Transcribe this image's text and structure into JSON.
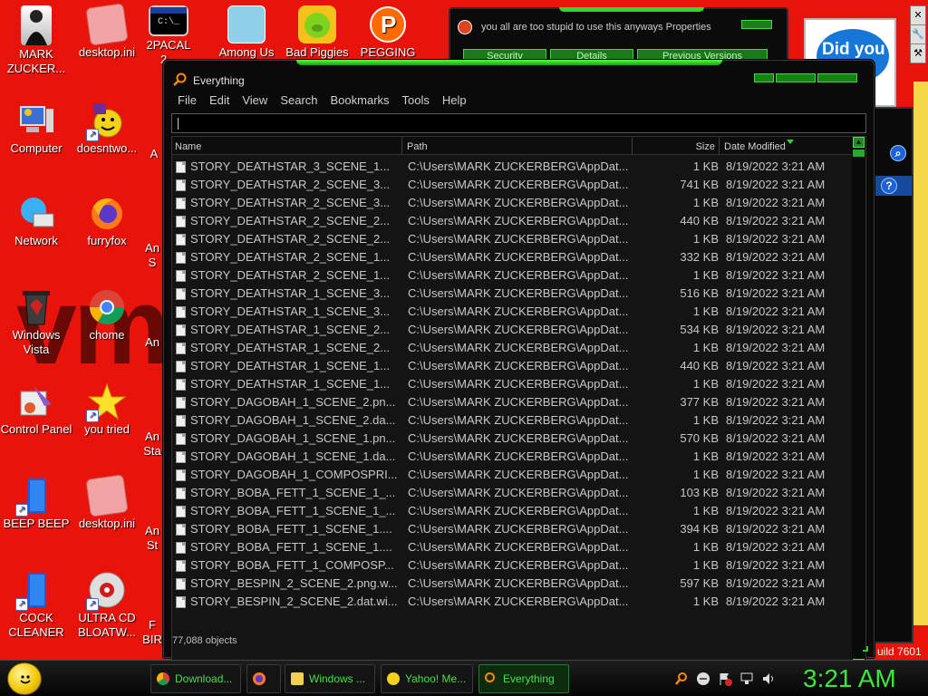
{
  "desktop": {
    "wallpaper_text": "vmO",
    "icons": [
      {
        "id": "mark-zuckerberg",
        "label": "MARK ZUCKER...",
        "icon": "user-figure-icon"
      },
      {
        "id": "desktop-ini-1",
        "label": "desktop.ini",
        "icon": "file-icon"
      },
      {
        "id": "2pacal",
        "label": "2PACAL 2...",
        "icon": "terminal-icon"
      },
      {
        "id": "among-us",
        "label": "Among Us",
        "icon": "game-icon"
      },
      {
        "id": "bad-piggies",
        "label": "Bad Piggies",
        "icon": "pig-icon"
      },
      {
        "id": "pegging",
        "label": "PEGGING",
        "icon": "p-logo-icon"
      },
      {
        "id": "computer",
        "label": "Computer",
        "icon": "computer-icon"
      },
      {
        "id": "doesntwo",
        "label": "doesntwo...",
        "icon": "yahoo-messenger-icon"
      },
      {
        "id": "network",
        "label": "Network",
        "icon": "network-icon"
      },
      {
        "id": "furryfox",
        "label": "furryfox",
        "icon": "firefox-icon"
      },
      {
        "id": "windows-vista",
        "label": "Windows Vista",
        "icon": "recycle-bin-icon"
      },
      {
        "id": "chome",
        "label": "chome",
        "icon": "chrome-icon"
      },
      {
        "id": "control-panel",
        "label": "Control Panel",
        "icon": "control-panel-icon"
      },
      {
        "id": "you-tried",
        "label": "you tried",
        "icon": "star-icon"
      },
      {
        "id": "beep-beep",
        "label": "BEEP BEEP",
        "icon": "blue-file-icon"
      },
      {
        "id": "desktop-ini-2",
        "label": "desktop.ini",
        "icon": "file-icon"
      },
      {
        "id": "cock-cleaner",
        "label": "COCK CLEANER",
        "icon": "blue-file-icon"
      },
      {
        "id": "ultra-cd",
        "label": "ULTRA CD BLOATW...",
        "icon": "cd-icon"
      },
      {
        "id": "partial-a1",
        "label": "A"
      },
      {
        "id": "partial-an1",
        "label": "An S"
      },
      {
        "id": "partial-an2",
        "label": "An"
      },
      {
        "id": "partial-an3",
        "label": "An Sta"
      },
      {
        "id": "partial-an4",
        "label": "An St"
      },
      {
        "id": "partial-bir",
        "label": "F BIR"
      }
    ]
  },
  "properties_window": {
    "title": "you all are too stupid to use this anyways Properties",
    "tabs": [
      "Security",
      "Details",
      "Previous Versions"
    ]
  },
  "side_window": {
    "did_you": "Did you",
    "help": "?",
    "build": "uild 7601"
  },
  "everything": {
    "title": "Everything",
    "menu": [
      "File",
      "Edit",
      "View",
      "Search",
      "Bookmarks",
      "Tools",
      "Help"
    ],
    "search_value": "",
    "columns": {
      "name": "Name",
      "path": "Path",
      "size": "Size",
      "date": "Date Modified"
    },
    "rows": [
      {
        "name": "STORY_DEATHSTAR_3_SCENE_1...",
        "path": "C:\\Users\\MARK ZUCKERBERG\\AppDat...",
        "size": "1 KB",
        "date": "8/19/2022 3:21 AM"
      },
      {
        "name": "STORY_DEATHSTAR_2_SCENE_3...",
        "path": "C:\\Users\\MARK ZUCKERBERG\\AppDat...",
        "size": "741 KB",
        "date": "8/19/2022 3:21 AM"
      },
      {
        "name": "STORY_DEATHSTAR_2_SCENE_3...",
        "path": "C:\\Users\\MARK ZUCKERBERG\\AppDat...",
        "size": "1 KB",
        "date": "8/19/2022 3:21 AM"
      },
      {
        "name": "STORY_DEATHSTAR_2_SCENE_2...",
        "path": "C:\\Users\\MARK ZUCKERBERG\\AppDat...",
        "size": "440 KB",
        "date": "8/19/2022 3:21 AM"
      },
      {
        "name": "STORY_DEATHSTAR_2_SCENE_2...",
        "path": "C:\\Users\\MARK ZUCKERBERG\\AppDat...",
        "size": "1 KB",
        "date": "8/19/2022 3:21 AM"
      },
      {
        "name": "STORY_DEATHSTAR_2_SCENE_1...",
        "path": "C:\\Users\\MARK ZUCKERBERG\\AppDat...",
        "size": "332 KB",
        "date": "8/19/2022 3:21 AM"
      },
      {
        "name": "STORY_DEATHSTAR_2_SCENE_1...",
        "path": "C:\\Users\\MARK ZUCKERBERG\\AppDat...",
        "size": "1 KB",
        "date": "8/19/2022 3:21 AM"
      },
      {
        "name": "STORY_DEATHSTAR_1_SCENE_3...",
        "path": "C:\\Users\\MARK ZUCKERBERG\\AppDat...",
        "size": "516 KB",
        "date": "8/19/2022 3:21 AM"
      },
      {
        "name": "STORY_DEATHSTAR_1_SCENE_3...",
        "path": "C:\\Users\\MARK ZUCKERBERG\\AppDat...",
        "size": "1 KB",
        "date": "8/19/2022 3:21 AM"
      },
      {
        "name": "STORY_DEATHSTAR_1_SCENE_2...",
        "path": "C:\\Users\\MARK ZUCKERBERG\\AppDat...",
        "size": "534 KB",
        "date": "8/19/2022 3:21 AM"
      },
      {
        "name": "STORY_DEATHSTAR_1_SCENE_2...",
        "path": "C:\\Users\\MARK ZUCKERBERG\\AppDat...",
        "size": "1 KB",
        "date": "8/19/2022 3:21 AM"
      },
      {
        "name": "STORY_DEATHSTAR_1_SCENE_1...",
        "path": "C:\\Users\\MARK ZUCKERBERG\\AppDat...",
        "size": "440 KB",
        "date": "8/19/2022 3:21 AM"
      },
      {
        "name": "STORY_DEATHSTAR_1_SCENE_1...",
        "path": "C:\\Users\\MARK ZUCKERBERG\\AppDat...",
        "size": "1 KB",
        "date": "8/19/2022 3:21 AM"
      },
      {
        "name": "STORY_DAGOBAH_1_SCENE_2.pn...",
        "path": "C:\\Users\\MARK ZUCKERBERG\\AppDat...",
        "size": "377 KB",
        "date": "8/19/2022 3:21 AM"
      },
      {
        "name": "STORY_DAGOBAH_1_SCENE_2.da...",
        "path": "C:\\Users\\MARK ZUCKERBERG\\AppDat...",
        "size": "1 KB",
        "date": "8/19/2022 3:21 AM"
      },
      {
        "name": "STORY_DAGOBAH_1_SCENE_1.pn...",
        "path": "C:\\Users\\MARK ZUCKERBERG\\AppDat...",
        "size": "570 KB",
        "date": "8/19/2022 3:21 AM"
      },
      {
        "name": "STORY_DAGOBAH_1_SCENE_1.da...",
        "path": "C:\\Users\\MARK ZUCKERBERG\\AppDat...",
        "size": "1 KB",
        "date": "8/19/2022 3:21 AM"
      },
      {
        "name": "STORY_DAGOBAH_1_COMPOSPRI...",
        "path": "C:\\Users\\MARK ZUCKERBERG\\AppDat...",
        "size": "1 KB",
        "date": "8/19/2022 3:21 AM"
      },
      {
        "name": "STORY_BOBA_FETT_1_SCENE_1_...",
        "path": "C:\\Users\\MARK ZUCKERBERG\\AppDat...",
        "size": "103 KB",
        "date": "8/19/2022 3:21 AM"
      },
      {
        "name": "STORY_BOBA_FETT_1_SCENE_1_...",
        "path": "C:\\Users\\MARK ZUCKERBERG\\AppDat...",
        "size": "1 KB",
        "date": "8/19/2022 3:21 AM"
      },
      {
        "name": "STORY_BOBA_FETT_1_SCENE_1....",
        "path": "C:\\Users\\MARK ZUCKERBERG\\AppDat...",
        "size": "394 KB",
        "date": "8/19/2022 3:21 AM"
      },
      {
        "name": "STORY_BOBA_FETT_1_SCENE_1....",
        "path": "C:\\Users\\MARK ZUCKERBERG\\AppDat...",
        "size": "1 KB",
        "date": "8/19/2022 3:21 AM"
      },
      {
        "name": "STORY_BOBA_FETT_1_COMPOSP...",
        "path": "C:\\Users\\MARK ZUCKERBERG\\AppDat...",
        "size": "1 KB",
        "date": "8/19/2022 3:21 AM"
      },
      {
        "name": "STORY_BESPIN_2_SCENE_2.png.w...",
        "path": "C:\\Users\\MARK ZUCKERBERG\\AppDat...",
        "size": "597 KB",
        "date": "8/19/2022 3:21 AM"
      },
      {
        "name": "STORY_BESPIN_2_SCENE_2.dat.wi...",
        "path": "C:\\Users\\MARK ZUCKERBERG\\AppDat...",
        "size": "1 KB",
        "date": "8/19/2022 3:21 AM"
      }
    ],
    "status": "77,088 objects"
  },
  "taskbar": {
    "buttons": [
      {
        "label": "Download...",
        "icon": "chrome-icon"
      },
      {
        "label": "",
        "icon": "firefox-icon"
      },
      {
        "label": "Windows ...",
        "icon": "folder-icon"
      },
      {
        "label": "Yahoo! Me...",
        "icon": "yahoo-messenger-icon"
      },
      {
        "label": "Everything",
        "icon": "search-icon",
        "active": true
      }
    ],
    "clock": "3:21 AM"
  },
  "colors": {
    "wallpaper": "#e8140c",
    "accent": "#3ce63c",
    "window_bg": "#0a0a0a"
  }
}
